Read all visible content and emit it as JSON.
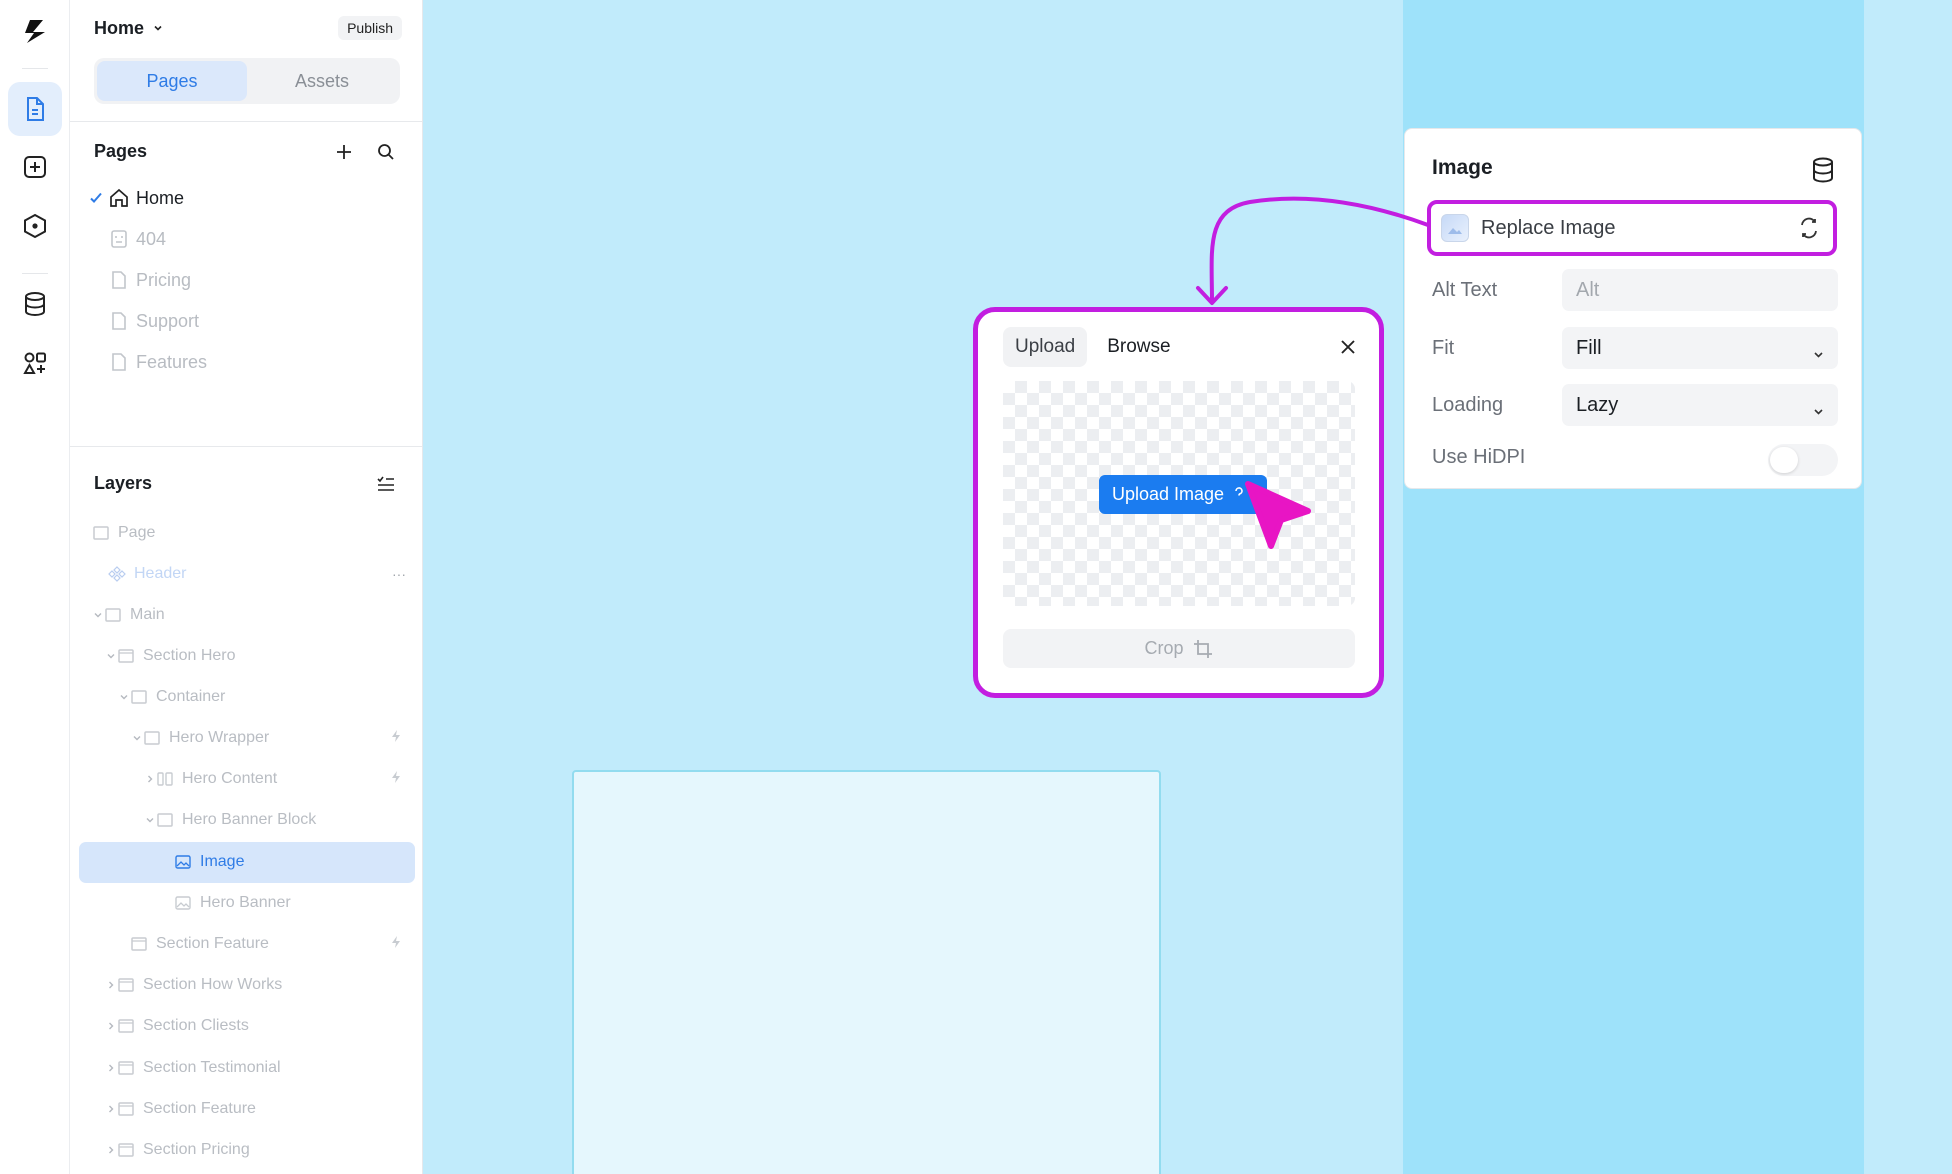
{
  "rail": {
    "items": [
      {
        "name": "logo-icon"
      },
      {
        "name": "pages-icon",
        "active": true
      },
      {
        "name": "add-element-icon"
      },
      {
        "name": "components-icon"
      },
      {
        "name": "database-icon"
      },
      {
        "name": "apps-icon"
      }
    ]
  },
  "sidebar": {
    "project_name": "Home",
    "publish_label": "Publish",
    "tabs": [
      {
        "label": "Pages",
        "active": true
      },
      {
        "label": "Assets",
        "active": false
      }
    ],
    "pages_title": "Pages",
    "pages": [
      {
        "label": "Home",
        "current": true,
        "icon": "home-icon"
      },
      {
        "label": "404",
        "icon": "page-404-icon"
      },
      {
        "label": "Pricing",
        "icon": "page-icon"
      },
      {
        "label": "Support",
        "icon": "page-icon"
      },
      {
        "label": "Features",
        "icon": "page-icon"
      }
    ],
    "layers_title": "Layers",
    "layers": [
      {
        "label": "Page"
      },
      {
        "label": "Header"
      },
      {
        "label": "Main"
      },
      {
        "label": "Section Hero"
      },
      {
        "label": "Container"
      },
      {
        "label": "Hero Wrapper"
      },
      {
        "label": "Hero Content"
      },
      {
        "label": "Hero Banner Block"
      },
      {
        "label": "Image",
        "selected": true
      },
      {
        "label": "Hero Banner"
      },
      {
        "label": "Section Feature"
      },
      {
        "label": "Section How Works"
      },
      {
        "label": "Section Cliests"
      },
      {
        "label": "Section Testimonial"
      },
      {
        "label": "Section Feature"
      },
      {
        "label": "Section Pricing"
      }
    ]
  },
  "inspector": {
    "title": "Image",
    "replace_label": "Replace Image",
    "alt_label": "Alt Text",
    "alt_placeholder": "Alt",
    "fit_label": "Fit",
    "fit_value": "Fill",
    "loading_label": "Loading",
    "loading_value": "Lazy",
    "hidpi_label": "Use HiDPI",
    "hidpi_on": false
  },
  "upload_popup": {
    "tabs": [
      {
        "label": "Upload",
        "active": true
      },
      {
        "label": "Browse",
        "active": false
      }
    ],
    "upload_button": "Upload Image",
    "crop_label": "Crop"
  },
  "colors": {
    "accent": "#1b7cf0",
    "highlight": "#c21ee0",
    "canvas": "#c1ebfb",
    "cursor": "#e815c4"
  }
}
